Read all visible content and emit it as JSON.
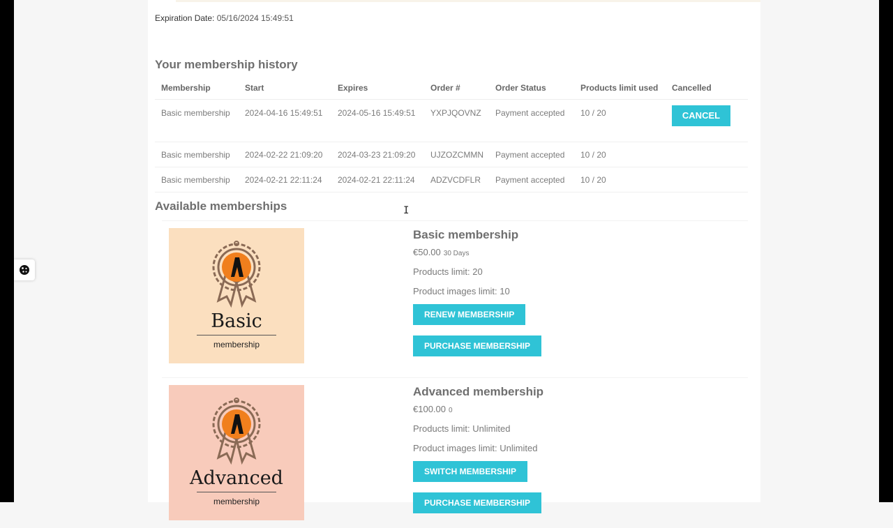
{
  "expiration": {
    "label": "Expiration Date:",
    "value": "05/16/2024 15:49:51"
  },
  "history": {
    "title": "Your membership history",
    "columns": [
      "Membership",
      "Start",
      "Expires",
      "Order #",
      "Order Status",
      "Products limit used",
      "Cancelled"
    ],
    "rows": [
      {
        "membership": "Basic membership",
        "start": "2024-04-16 15:49:51",
        "expires": "2024-05-16 15:49:51",
        "order": "YXPJQOVNZ",
        "status": "Payment accepted",
        "limit": "10 / 20",
        "cancel": "CANCEL"
      },
      {
        "membership": "Basic membership",
        "start": "2024-02-22 21:09:20",
        "expires": "2024-03-23 21:09:20",
        "order": "UJZOZCMMN",
        "status": "Payment accepted",
        "limit": "10 / 20",
        "cancel": ""
      },
      {
        "membership": "Basic membership",
        "start": "2024-02-21 22:11:24",
        "expires": "2024-02-21 22:11:24",
        "order": "ADZVCDFLR",
        "status": "Payment accepted",
        "limit": "10 / 20",
        "cancel": ""
      }
    ]
  },
  "available": {
    "title": "Available memberships",
    "items": [
      {
        "image_title": "Basic",
        "image_sub": "membership",
        "name": "Basic membership",
        "price": "€50.00",
        "duration": "30 Days",
        "products_limit": "Products limit: 20",
        "images_limit": "Product images limit: 10",
        "button1": "RENEW MEMBERSHIP",
        "button2": "PURCHASE MEMBERSHIP",
        "thumb_color": "#fbdfbf"
      },
      {
        "image_title": "Advanced",
        "image_sub": "membership",
        "name": "Advanced membership",
        "price": "€100.00",
        "duration": "0",
        "products_limit": "Products limit: Unlimited",
        "images_limit": "Product images limit: Unlimited",
        "button1": "SWITCH MEMBERSHIP",
        "button2": "PURCHASE MEMBERSHIP",
        "thumb_color": "#f8cbbb"
      }
    ]
  },
  "colors": {
    "accent": "#2fc3d6",
    "badge_orange": "#f07f1d"
  },
  "icons": {
    "cookie": "cookie-icon",
    "cursor": "text-cursor-icon",
    "badge": "award-ribbon-icon"
  }
}
